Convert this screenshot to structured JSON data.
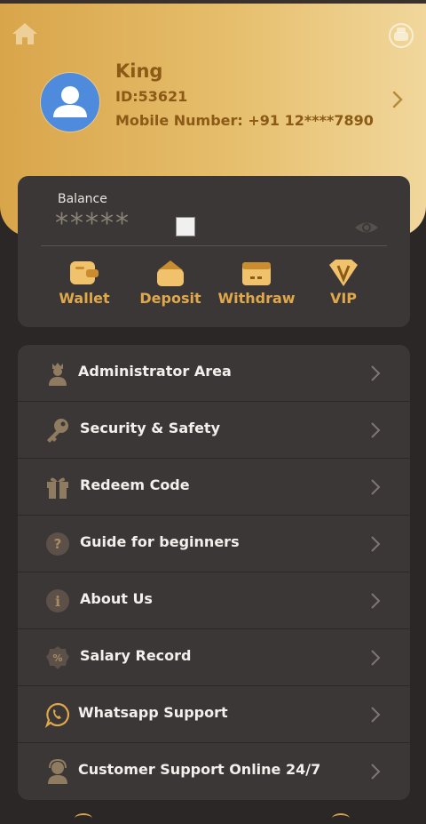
{
  "header": {
    "user_name": "King",
    "user_id": "ID:53621",
    "mobile": "Mobile Number: +91 12****7890"
  },
  "balance": {
    "label": "Balance",
    "value": "*****"
  },
  "actions": [
    {
      "label": "Wallet",
      "icon": "wallet-icon"
    },
    {
      "label": "Deposit",
      "icon": "deposit-icon"
    },
    {
      "label": "Withdraw",
      "icon": "withdraw-icon"
    },
    {
      "label": "VIP",
      "icon": "vip-icon"
    }
  ],
  "menu": [
    {
      "label": "Administrator Area",
      "icon": "admin-icon"
    },
    {
      "label": "Security & Safety",
      "icon": "key-icon"
    },
    {
      "label": "Redeem Code",
      "icon": "gift-icon"
    },
    {
      "label": "Guide for beginners",
      "icon": "question-icon"
    },
    {
      "label": "About Us",
      "icon": "info-icon"
    },
    {
      "label": "Salary Record",
      "icon": "percent-badge-icon"
    },
    {
      "label": "Whatsapp Support",
      "icon": "whatsapp-icon"
    },
    {
      "label": "Customer Support Online 24/7",
      "icon": "support-agent-icon"
    }
  ],
  "colors": {
    "accent_gold": "#d9a54a",
    "header_gradient_end": "#f1d79c",
    "card_bg": "#3a3736",
    "page_bg": "#2b2726",
    "name_text": "#8a5a16"
  }
}
